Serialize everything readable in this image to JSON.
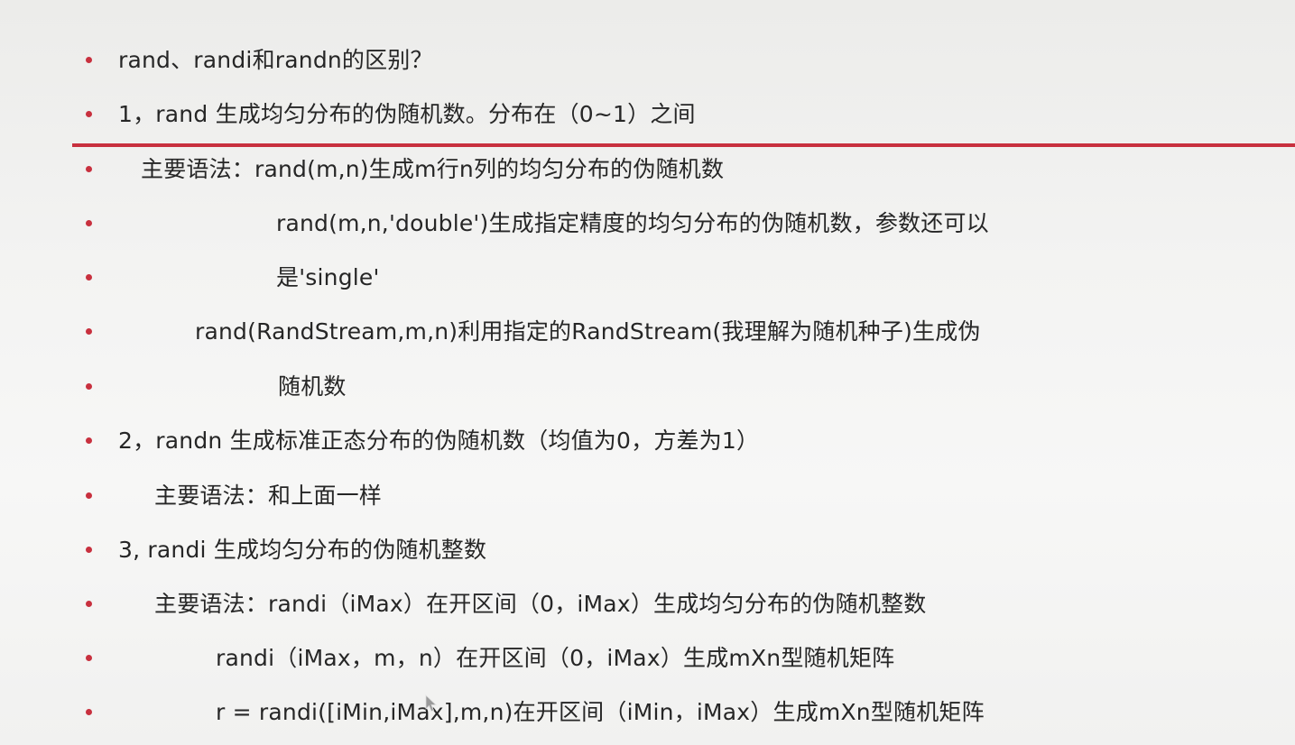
{
  "colors": {
    "accent": "#c8303e",
    "text": "#262626"
  },
  "lines": [
    "rand、randi和randn的区别？",
    "1，rand 生成均匀分布的伪随机数。分布在（0~1）之间",
    "主要语法：rand(m,n)生成m行n列的均匀分布的伪随机数",
    "rand(m,n,'double')生成指定精度的均匀分布的伪随机数，参数还可以",
    "是'single'",
    "rand(RandStream,m,n)利用指定的RandStream(我理解为随机种子)生成伪",
    "随机数",
    "2，randn 生成标准正态分布的伪随机数（均值为0，方差为1）",
    "主要语法：和上面一样",
    "3, randi 生成均匀分布的伪随机整数",
    "主要语法：randi（iMax）在开区间（0，iMax）生成均匀分布的伪随机整数",
    "randi（iMax，m，n）在开区间（0，iMax）生成mXn型随机矩阵",
    "r = randi([iMin,iMax],m,n)在开区间（iMin，iMax）生成mXn型随机矩阵"
  ]
}
